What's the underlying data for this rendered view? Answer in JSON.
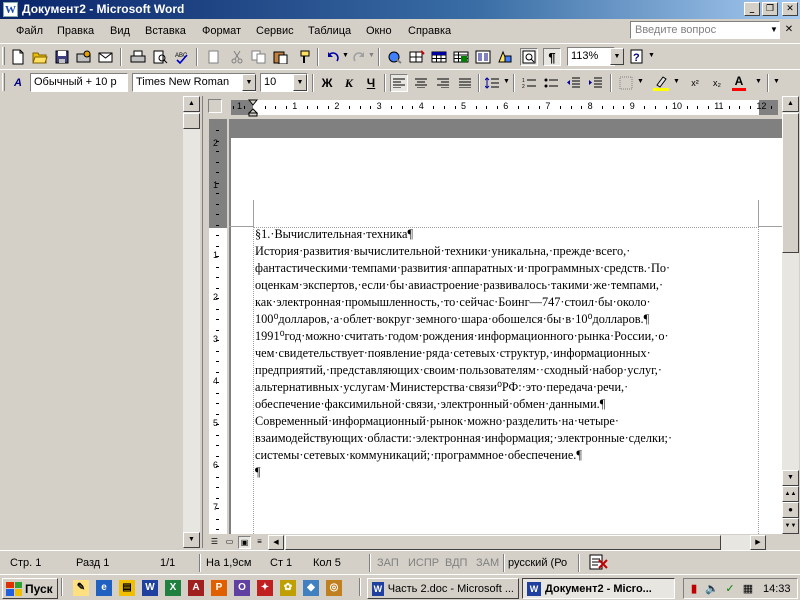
{
  "window": {
    "title": "Документ2 - Microsoft Word",
    "app_icon": "W"
  },
  "menu": {
    "items": [
      "Файл",
      "Правка",
      "Вид",
      "Вставка",
      "Формат",
      "Сервис",
      "Таблица",
      "Окно",
      "Справка"
    ],
    "ask_placeholder": "Введите вопрос"
  },
  "standard_toolbar": {
    "zoom": "113%",
    "icons": [
      "new-icon",
      "open-icon",
      "save-icon",
      "permission-icon",
      "email-icon",
      "print-icon",
      "print-preview-icon",
      "spelling-icon",
      "research-icon",
      "cut-icon",
      "copy-icon",
      "paste-icon",
      "format-painter-icon",
      "undo-icon",
      "redo-icon",
      "hyperlink-icon",
      "tables-borders-icon",
      "insert-table-icon",
      "insert-excel-icon",
      "columns-icon",
      "drawing-icon",
      "document-map-icon",
      "show-formatting-icon",
      "help-icon"
    ]
  },
  "formatting_toolbar": {
    "style": "Обычный + 10 р",
    "font": "Times New Roman",
    "size": "10",
    "bold": "Ж",
    "italic": "К",
    "underline": "Ч",
    "superscript": "x²",
    "subscript": "x₂",
    "font_color_letter": "A",
    "highlight_color": "#ffff00",
    "font_color": "#ff0000"
  },
  "ruler": {
    "numbers": [
      "1",
      "2",
      "3",
      "4",
      "5",
      "6",
      "7",
      "8",
      "9",
      "10",
      "11",
      "12"
    ],
    "left_margin": "1",
    "vertical_numbers": [
      "2",
      "1",
      "1",
      "2",
      "3",
      "4",
      "5",
      "6",
      "7"
    ]
  },
  "document": {
    "lines": [
      "§1.·Вычислительная·техника¶",
      "История·развития·вычислительной·техники·уникальна,·прежде·всего,·",
      "фантастическими·темпами·развития·аппаратных·и·программных·средств.·По·",
      "оценкам·экспертов,·если·бы·авиастроение·развивалось·такими·же·темпами,·",
      "как·электронная·промышленность,·то·сейчас·Боинг—747·стоил·бы·около·",
      "100⁰долларов,·а·облет·вокруг·земного·шара·обошелся·бы·в·10⁰долларов.¶",
      "1991⁰год·можно·считать·годом·рождения·информационного·рынка·России,·о·",
      "чем·свидетельствует·появление·ряда·сетевых·структур,·информационных·",
      "предприятий,·представляющих·своим·пользователям··сходный·набор·услуг,·",
      "альтернативных·услугам·Министерства·связи⁰РФ:·это·передача·речи,·",
      "обеспечение·факсимильной·связи,·электронный·обмен·данными.¶",
      "Современный·информационный·рынок·можно·разделить·на·четыре·",
      "взаимодействующих·области:·электронная·информация;·электронные·сделки;·",
      "системы·сетевых·коммуникаций;·программное·обеспечение.¶",
      "¶"
    ]
  },
  "statusbar": {
    "page": "Стр. 1",
    "section": "Разд 1",
    "pages": "1/1",
    "at": "На 1,9см",
    "line": "Ст 1",
    "col": "Кол 5",
    "rec": "ЗАП",
    "trk": "ИСПР",
    "ext": "ВДП",
    "ovr": "ЗАМ",
    "language": "русский (Ро"
  },
  "taskbar": {
    "start": "Пуск",
    "tasks": [
      "Часть 2.doc - Microsoft ...",
      "Документ2 - Micro..."
    ],
    "time": "14:33"
  }
}
